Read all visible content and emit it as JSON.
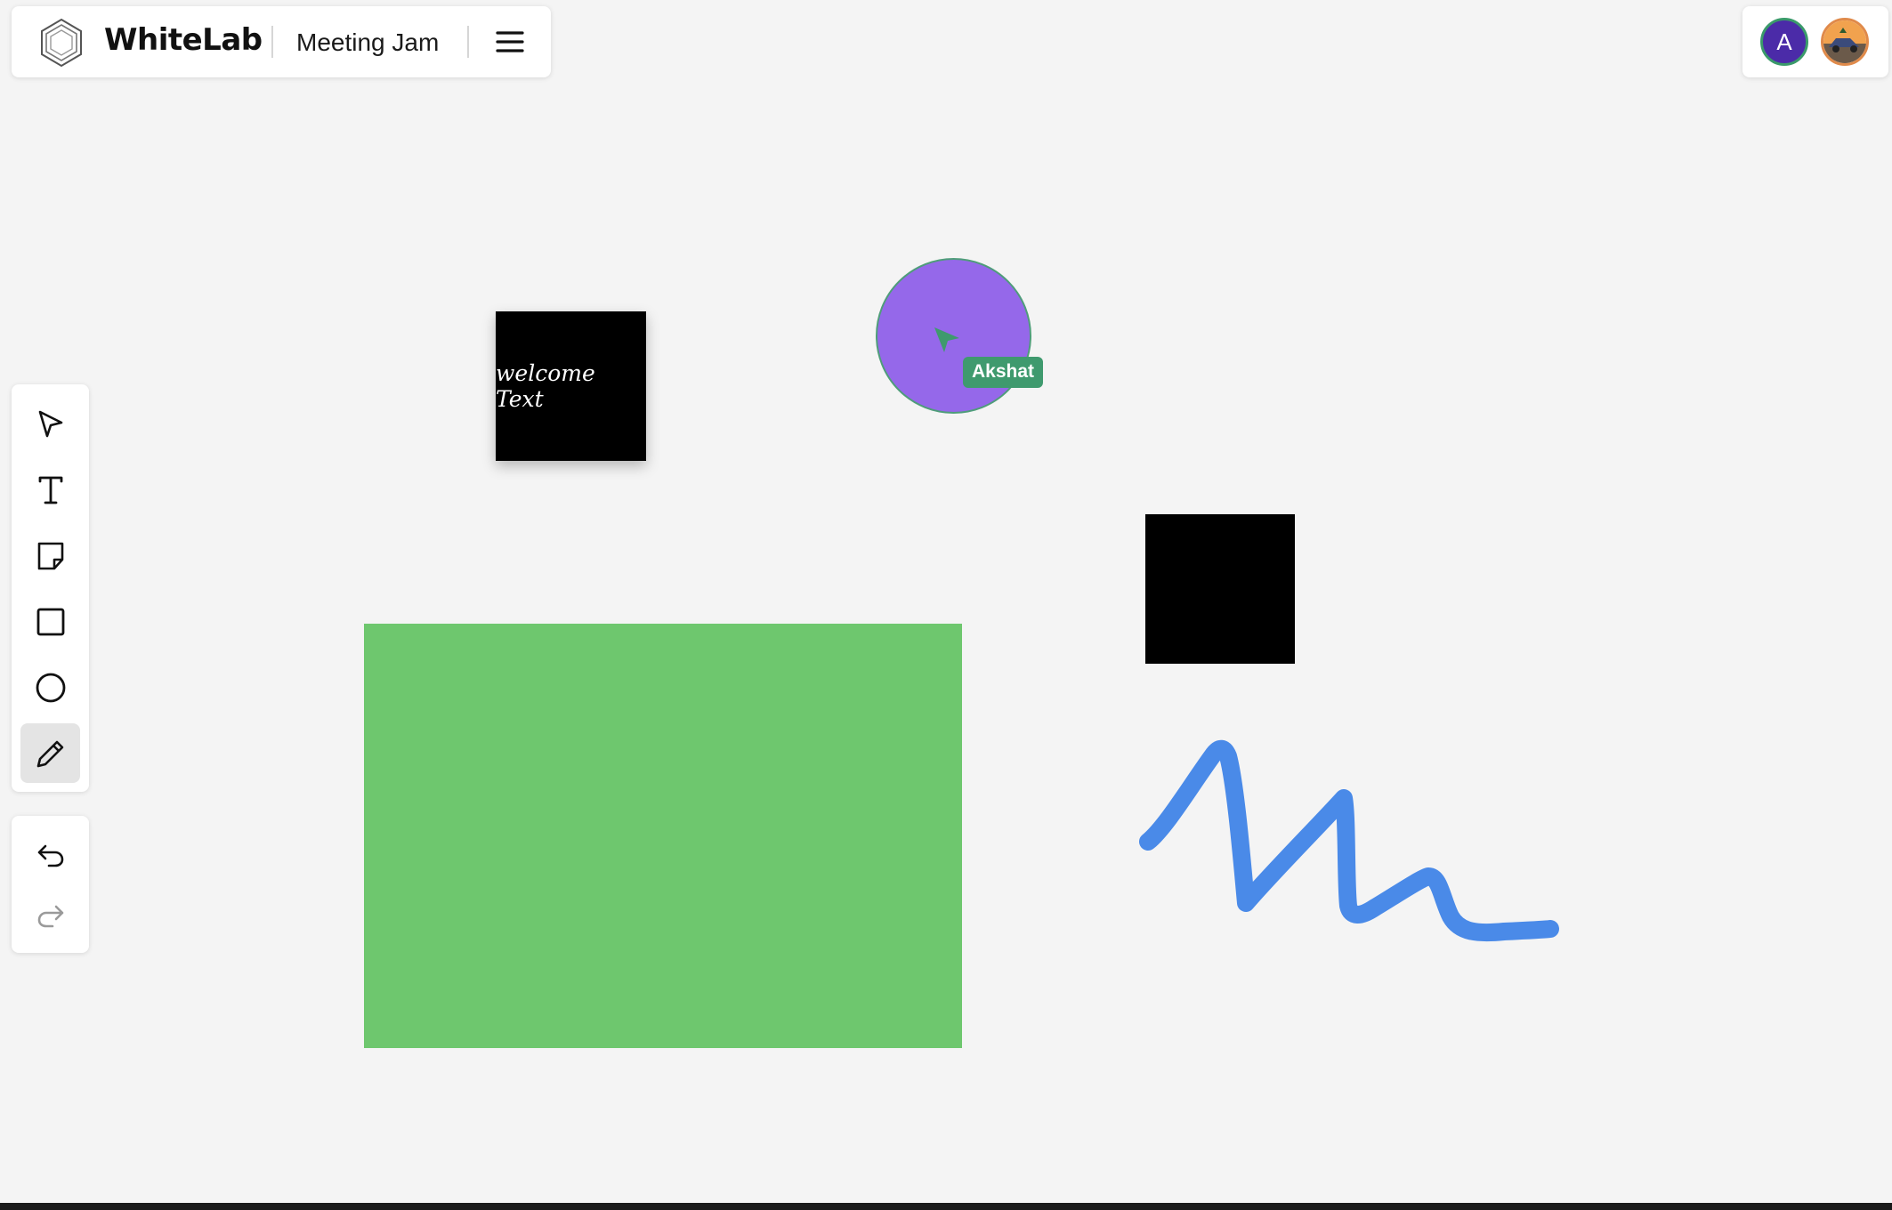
{
  "header": {
    "app_name": "WhiteLab",
    "board_name": "Meeting Jam"
  },
  "icons": {
    "logo": "whitelab-hexagon-logo-icon",
    "menu": "hamburger-menu-icon",
    "tools": [
      "select-arrow-icon",
      "text-icon",
      "sticky-note-icon",
      "rectangle-icon",
      "ellipse-icon",
      "pencil-icon"
    ],
    "history": [
      "undo-icon",
      "redo-icon"
    ]
  },
  "users": {
    "avatar_initial": "A"
  },
  "toolbar": {
    "active_tool": "pencil"
  },
  "canvas": {
    "sticky_note_text": "welcome Text",
    "collaborator_cursor_name": "Akshat"
  },
  "colors": {
    "canvas_background": "#f4f4f4",
    "sticky_note": "#000000",
    "circle_fill": "#9568ea",
    "cursor_accent": "#3f9a6e",
    "rectangle_fill": "#6ec76e",
    "square_fill": "#000000",
    "scribble_stroke": "#4a8ae8",
    "avatar_bg": "#4b2ba8"
  }
}
